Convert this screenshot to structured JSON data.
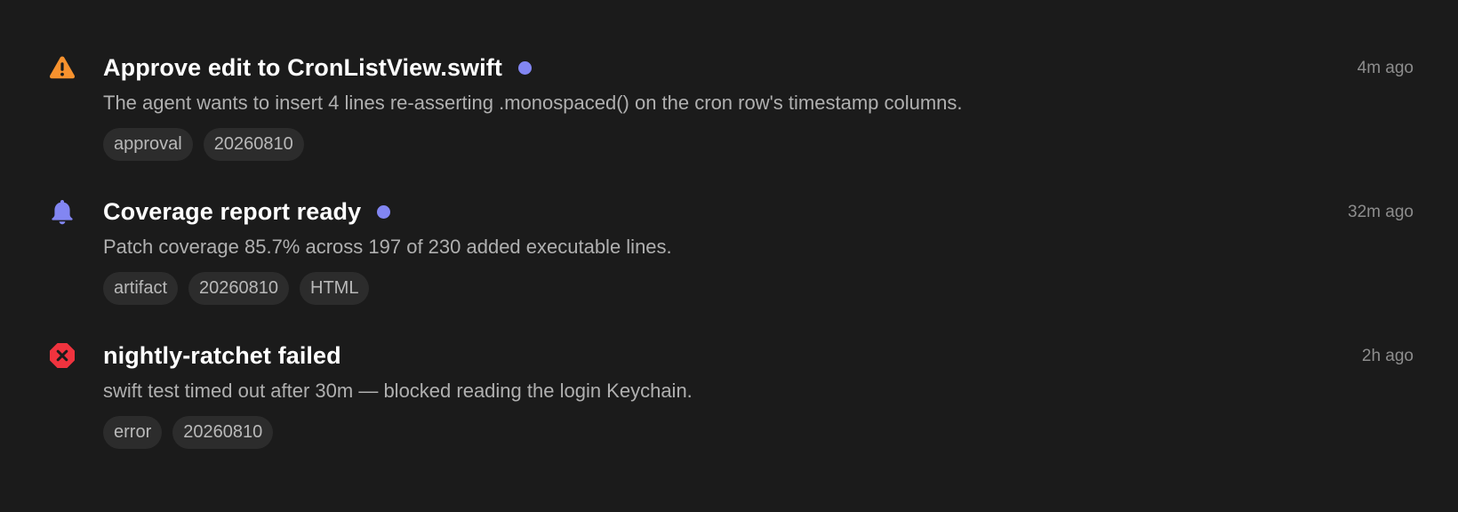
{
  "colors": {
    "background": "#1b1b1b",
    "unread_dot": "#8286f2",
    "warning_icon": "#f7922e",
    "bell_icon": "#8286f2",
    "error_icon": "#f0333e",
    "tag_background": "#2c2c2c"
  },
  "notifications": [
    {
      "icon": "warning-triangle-icon",
      "title": "Approve edit to CronListView.swift",
      "unread": true,
      "time": "4m ago",
      "description": "The agent wants to insert 4 lines re-asserting .monospaced() on the cron row's timestamp columns.",
      "tags": [
        "approval",
        "20260810"
      ]
    },
    {
      "icon": "bell-icon",
      "title": "Coverage report ready",
      "unread": true,
      "time": "32m ago",
      "description": "Patch coverage 85.7% across 197 of 230 added executable lines.",
      "tags": [
        "artifact",
        "20260810",
        "HTML"
      ]
    },
    {
      "icon": "error-octagon-icon",
      "title": "nightly-ratchet failed",
      "unread": false,
      "time": "2h ago",
      "description": "swift test timed out after 30m — blocked reading the login Keychain.",
      "tags": [
        "error",
        "20260810"
      ]
    }
  ]
}
